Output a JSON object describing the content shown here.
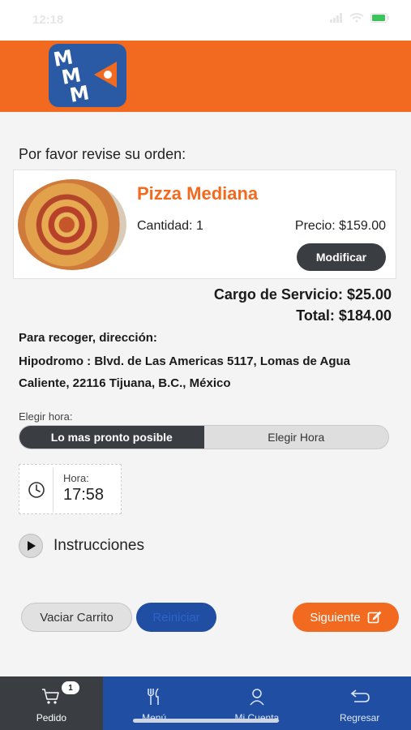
{
  "status_bar": {
    "time": "12:18"
  },
  "header": {
    "logo_letters": [
      "M",
      "M",
      "M"
    ]
  },
  "order": {
    "prompt": "Por favor revise su orden:",
    "item": {
      "name": "Pizza Mediana",
      "quantity": "Cantidad: 1",
      "price": "Precio: $159.00",
      "modify_label": "Modificar"
    },
    "service_fee": "Cargo de Servicio: $25.00",
    "total": "Total: $184.00",
    "pickup_label": "Para recoger, dirección:",
    "pickup_address": "Hipodromo : Blvd. de Las Americas 5117, Lomas de Agua Caliente, 22116 Tijuana, B.C., México"
  },
  "time_choice": {
    "label": "Elegir hora:",
    "options": [
      "Lo mas pronto posible",
      "Elegir Hora"
    ],
    "selected": "Lo mas pronto posible"
  },
  "time_box": {
    "label": "Hora:",
    "value": "17:58"
  },
  "instructions": {
    "label": "Instrucciones"
  },
  "actions": {
    "clear_cart": "Vaciar Carrito",
    "restart": "Reiniciar",
    "next": "Siguiente"
  },
  "tabbar": {
    "items": [
      {
        "label": "Pedido",
        "icon": "cart-icon",
        "badge": "1"
      },
      {
        "label": "Menú",
        "icon": "fork-knife-icon"
      },
      {
        "label": "Mi Cuenta",
        "icon": "user-icon"
      },
      {
        "label": "Regresar",
        "icon": "return-icon"
      }
    ]
  },
  "colors": {
    "brand_orange": "#f26a1f",
    "brand_blue": "#1f4ea3",
    "dark_button": "#3a3d42"
  }
}
